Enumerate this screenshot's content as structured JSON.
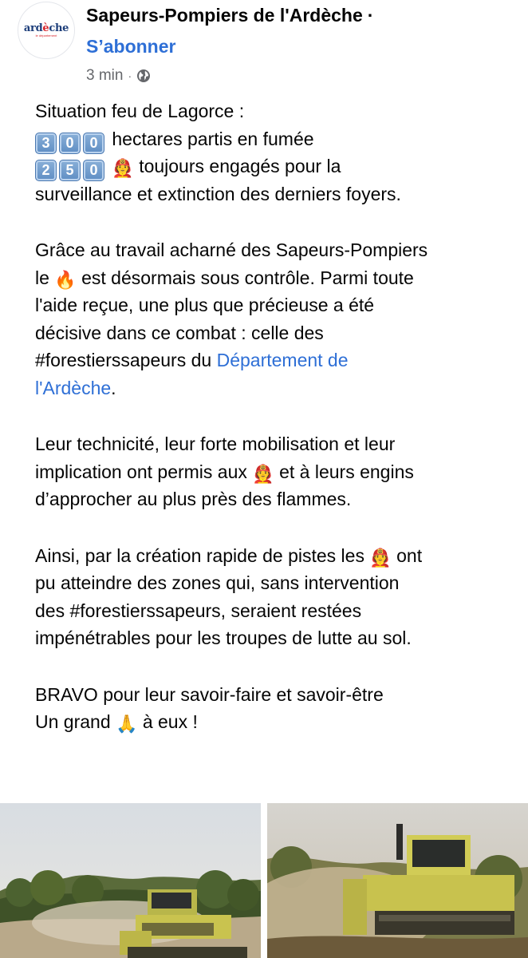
{
  "post": {
    "author": {
      "avatar_text_main": "ardèche",
      "avatar_text_sub": "le département",
      "page_name": "Sapeurs-Pompiers de l'Ardèche",
      "dot": "·",
      "follow_label": "S’abonner"
    },
    "meta": {
      "time": "3 min",
      "separator": "·",
      "audience_icon": "globe-icon"
    },
    "body": {
      "line1": "Situation feu de Lagorce :",
      "hectares_digits": [
        "3",
        "0",
        "0"
      ],
      "hectares_text": "hectares partis en fumée",
      "firefighters_digits": [
        "2",
        "5",
        "0"
      ],
      "firefighters_text": "toujours engagés pour la",
      "line4": "surveillance et extinction des derniers foyers.",
      "p2_line1": "Grâce au travail acharné des Sapeurs-Pompiers",
      "p2_line2_a": "le",
      "p2_line2_b": "est désormais sous contrôle. Parmi toute",
      "p2_line3": "l'aide reçue, une plus que précieuse a été",
      "p2_line4": "décisive dans ce combat : celle des",
      "p2_line5_a": "#forestierssapeurs du",
      "p2_link_part1": "Département de",
      "p2_link_part2": "l'Ardèche",
      "p2_line6_end": ".",
      "p3_line1": "Leur technicité, leur forte mobilisation et leur",
      "p3_line2_a": "implication ont permis aux",
      "p3_line2_b": "et à leurs engins",
      "p3_line3": "d’approcher au plus près des flammes.",
      "p4_line1_a": "Ainsi, par la création rapide de pistes les",
      "p4_line1_b": "ont",
      "p4_line2": "pu atteindre des zones qui, sans intervention",
      "p4_line3": "des #forestierssapeurs, seraient restées",
      "p4_line4": "impénétrables pour les troupes de lutte au sol.",
      "p5_line1": "BRAVO pour leur savoir-faire et savoir-être",
      "p5_line2_a": "Un grand",
      "p5_line2_b": "à eux !",
      "emoji_firefighter": "🧑‍🚒",
      "emoji_fire": "🔥",
      "emoji_pray": "🙏"
    },
    "photos": [
      {
        "name": "photo-bulldozer-forest"
      },
      {
        "name": "photo-bulldozer-dust"
      }
    ],
    "colors": {
      "link": "#2e6fd6",
      "meta": "#65676b",
      "text": "#050505"
    }
  }
}
